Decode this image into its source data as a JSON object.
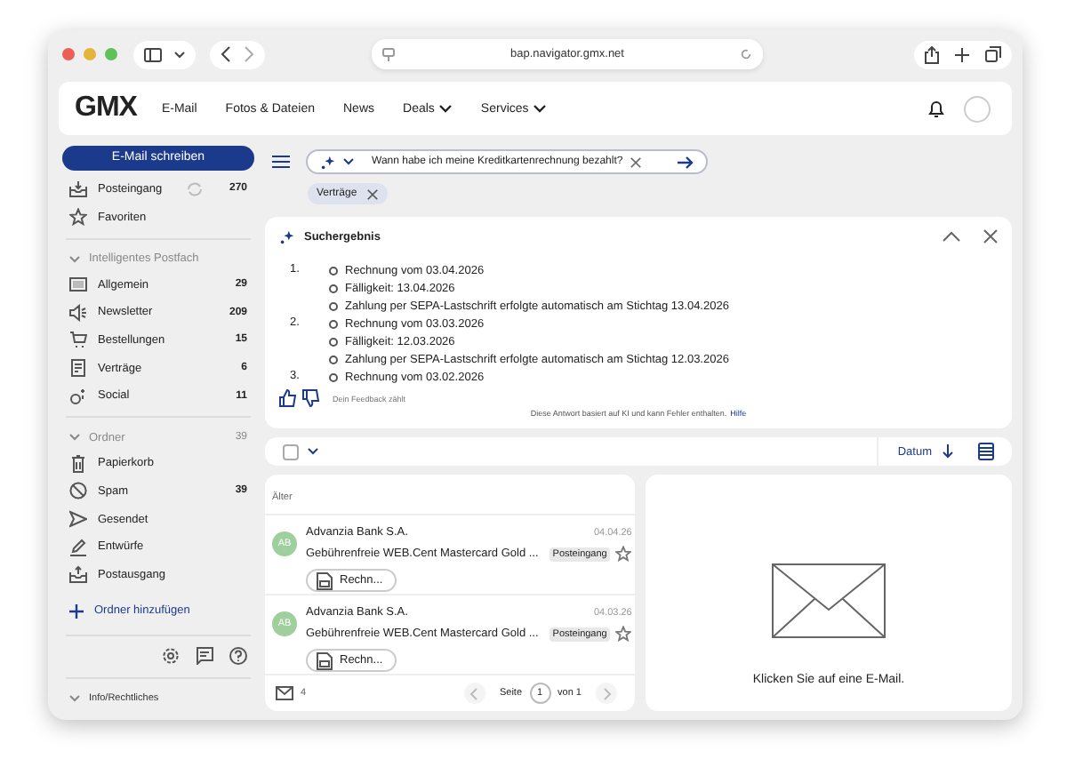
{
  "browser": {
    "url": "bap.navigator.gmx.net"
  },
  "header": {
    "logo": "GMX",
    "nav": [
      {
        "label": "E-Mail",
        "dropdown": false
      },
      {
        "label": "Fotos & Dateien",
        "dropdown": false
      },
      {
        "label": "News",
        "dropdown": false
      },
      {
        "label": "Deals",
        "dropdown": true
      },
      {
        "label": "Services",
        "dropdown": true
      }
    ]
  },
  "sidebar": {
    "compose": "E-Mail schreiben",
    "top": [
      {
        "kind": "inbox",
        "label": "Posteingang",
        "count": "270",
        "sync": true
      },
      {
        "kind": "star",
        "label": "Favoriten",
        "sync": false
      }
    ],
    "smart": {
      "title": "Intelligentes Postfach",
      "expanded": true,
      "items": [
        {
          "kind": "grid",
          "label": "Allgemein",
          "count": "29"
        },
        {
          "kind": "megaphone",
          "label": "Newsletter",
          "count": "209"
        },
        {
          "kind": "cart",
          "label": "Bestellungen",
          "count": "15"
        },
        {
          "kind": "contract",
          "label": "Verträge",
          "count": "6"
        },
        {
          "kind": "social",
          "label": "Social",
          "count": "11"
        }
      ]
    },
    "folders": {
      "title": "Ordner",
      "count": "39",
      "expanded": true,
      "items": [
        {
          "kind": "trash",
          "label": "Papierkorb"
        },
        {
          "kind": "spam",
          "label": "Spam",
          "count": "39"
        },
        {
          "kind": "send",
          "label": "Gesendet"
        },
        {
          "kind": "draft",
          "label": "Entwürfe"
        },
        {
          "kind": "inbox",
          "label": "Postausgang"
        }
      ]
    },
    "add_folder": "Ordner hinzufügen",
    "footer": "Info/Rechtliches"
  },
  "search": {
    "query": "Wann habe ich meine Kreditkartenrechnung bezahlt?"
  },
  "filter_chips": [
    {
      "label": "Verträge"
    }
  ],
  "result": {
    "title": "Suchergebnis",
    "items": [
      {
        "number": "1.",
        "lines": [
          "Rechnung vom 03.04.2026",
          "Fälligkeit: 13.04.2026",
          "Zahlung per SEPA-Lastschrift erfolgte automatisch am Stichtag 13.04.2026"
        ]
      },
      {
        "number": "2.",
        "lines": [
          "Rechnung vom 03.03.2026",
          "Fälligkeit: 12.03.2026",
          "Zahlung per SEPA-Lastschrift erfolgte automatisch am Stichtag 12.03.2026"
        ]
      },
      {
        "number": "3.",
        "lines": [
          "Rechnung vom 03.02.2026"
        ]
      }
    ],
    "feedback": "Dein Feedback zählt",
    "disclaimer": "Diese Antwort basiert auf KI und kann Fehler enthalten.",
    "help_link": "Hilfe"
  },
  "list_toolbar": {
    "select_all": false,
    "sort": "Datum"
  },
  "mail_list": {
    "group": "Älter",
    "mails": [
      {
        "initials": "AB",
        "sender": "Advanzia Bank S.A.",
        "date": "04.04.26",
        "subject": "Gebührenfreie WEB.Cent Mastercard Gold ...",
        "folder": "Posteingang",
        "starred": false,
        "attachment": "Rechn..."
      },
      {
        "initials": "AB",
        "sender": "Advanzia Bank S.A.",
        "date": "04.03.26",
        "subject": "Gebührenfreie WEB.Cent Mastercard Gold ...",
        "folder": "Posteingang",
        "starred": false,
        "attachment": "Rechn..."
      }
    ],
    "count": "4",
    "page_label": "Seite",
    "page": "1",
    "page_total": "von 1"
  },
  "preview": {
    "message": "Klicken Sie auf eine E-Mail."
  }
}
